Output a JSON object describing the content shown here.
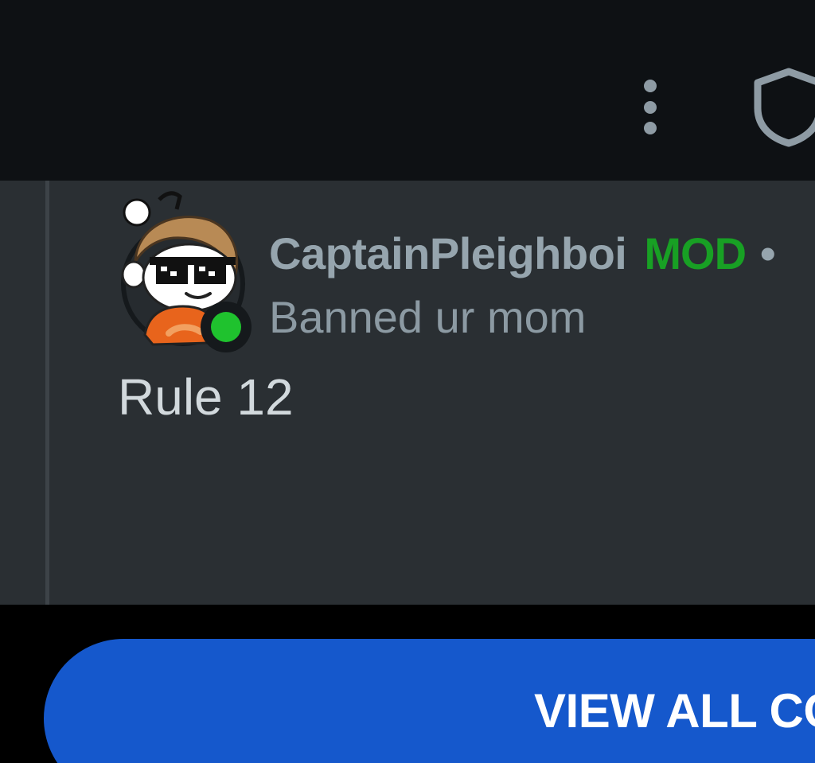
{
  "toolbar": {
    "more_icon": "more-vertical-icon",
    "shield_icon": "shield-icon"
  },
  "comment": {
    "author": "CaptainPleighboi",
    "role_badge": "MOD",
    "separator": "•",
    "flair": "Banned ur mom",
    "body": "Rule 12",
    "avatar_icon": "snoo-avatar-with-sunglasses",
    "online_status_icon": "online-dot-icon"
  },
  "footer": {
    "view_all_label": "VIEW ALL COMMENTS"
  },
  "colors": {
    "toolbar_bg": "#0e1114",
    "comment_bg": "#2a2f33",
    "author": "#96a5ae",
    "mod_badge": "#18a024",
    "online_dot": "#1fc22e",
    "button_bg": "#1558cc"
  }
}
